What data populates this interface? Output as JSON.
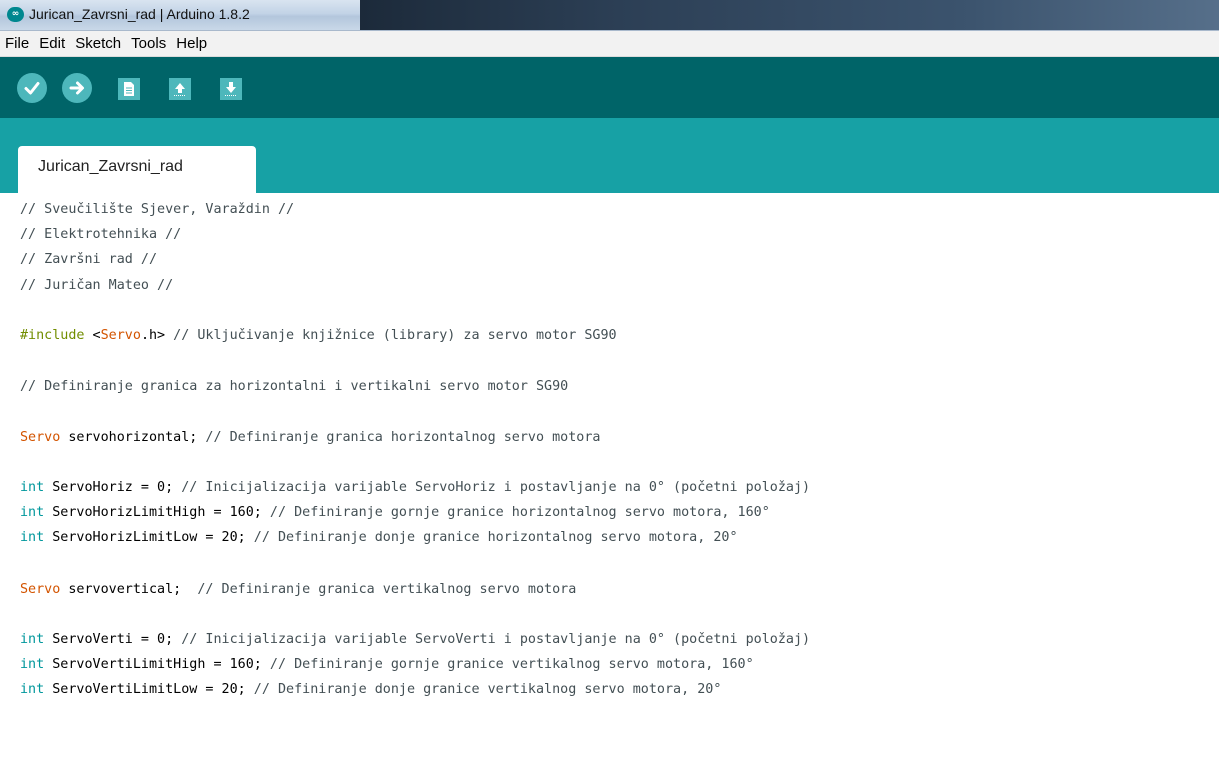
{
  "window": {
    "title": "Jurican_Zavrsni_rad | Arduino 1.8.2",
    "icon": "arduino-infinity-icon"
  },
  "menu": [
    "File",
    "Edit",
    "Sketch",
    "Tools",
    "Help"
  ],
  "toolbar": {
    "buttons": [
      {
        "name": "verify",
        "icon": "checkmark-icon"
      },
      {
        "name": "upload",
        "icon": "arrow-right-icon"
      },
      {
        "name": "new",
        "icon": "document-icon"
      },
      {
        "name": "open",
        "icon": "arrow-up-icon"
      },
      {
        "name": "save",
        "icon": "arrow-down-icon"
      }
    ]
  },
  "tabs": [
    {
      "label": "Jurican_Zavrsni_rad"
    }
  ],
  "colors": {
    "toolbar": "#006468",
    "tabstrip": "#17a1a5",
    "button": "#4db7bb",
    "keyword": "#00979c",
    "class": "#d35400",
    "preprocessor": "#728e00"
  },
  "code": {
    "l1": "// Sveučilište Sjever, Varaždin //",
    "l2": "// Elektrotehnika //",
    "l3": "// Završni rad //",
    "l4": "// Juričan Mateo //",
    "l6_pp": "#include",
    "l6_a": " <",
    "l6_cls": "Servo",
    "l6_b": ".h>",
    "l6_cm": " // Uključivanje knjižnice (library) za servo motor SG90",
    "l8": "// Definiranje granica za horizontalni i vertikalni servo motor SG90",
    "l10_cls": "Servo",
    "l10_a": " servohorizontal;",
    "l10_cm": " // Definiranje granica horizontalnog servo motora",
    "l12_kw": "int",
    "l12_a": " ServoHoriz = 0;",
    "l12_cm": " // Inicijalizacija varijable ServoHoriz i postavljanje na 0° (početni položaj)",
    "l13_kw": "int",
    "l13_a": " ServoHorizLimitHigh = 160;",
    "l13_cm": " // Definiranje gornje granice horizontalnog servo motora, 160°",
    "l14_kw": "int",
    "l14_a": " ServoHorizLimitLow = 20;",
    "l14_cm": " // Definiranje donje granice horizontalnog servo motora, 20°",
    "l16_cls": "Servo",
    "l16_a": " servovertical;",
    "l16_cm": "  // Definiranje granica vertikalnog servo motora",
    "l18_kw": "int",
    "l18_a": " ServoVerti = 0;",
    "l18_cm": " // Inicijalizacija varijable ServoVerti i postavljanje na 0° (početni položaj)",
    "l19_kw": "int",
    "l19_a": " ServoVertiLimitHigh = 160;",
    "l19_cm": " // Definiranje gornje granice vertikalnog servo motora, 160°",
    "l20_kw": "int",
    "l20_a": " ServoVertiLimitLow = 20;",
    "l20_cm": " // Definiranje donje granice vertikalnog servo motora, 20°"
  }
}
